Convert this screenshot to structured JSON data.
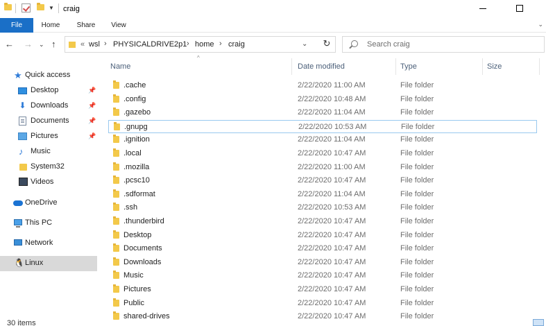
{
  "window": {
    "title": "craig"
  },
  "ribbon": {
    "tabs": [
      "File",
      "Home",
      "Share",
      "View"
    ]
  },
  "address": {
    "overflow": "«",
    "crumbs": [
      "wsl",
      "PHYSICALDRIVE2p1",
      "home",
      "craig"
    ]
  },
  "search": {
    "placeholder": "Search craig"
  },
  "nav": {
    "quick_access": "Quick access",
    "items": [
      {
        "label": "Desktop",
        "icon": "desktop-icon",
        "pinned": true
      },
      {
        "label": "Downloads",
        "icon": "download-icon",
        "pinned": true
      },
      {
        "label": "Documents",
        "icon": "document-icon",
        "pinned": true
      },
      {
        "label": "Pictures",
        "icon": "pictures-icon",
        "pinned": true
      },
      {
        "label": "Music",
        "icon": "music-icon",
        "pinned": false
      },
      {
        "label": "System32",
        "icon": "folder-icon",
        "pinned": false
      },
      {
        "label": "Videos",
        "icon": "video-icon",
        "pinned": false
      }
    ],
    "onedrive": "OneDrive",
    "thispc": "This PC",
    "network": "Network",
    "linux": "Linux"
  },
  "columns": {
    "name": "Name",
    "date": "Date modified",
    "type": "Type",
    "size": "Size"
  },
  "files": [
    {
      "name": ".cache",
      "date": "2/22/2020 11:00 AM",
      "type": "File folder"
    },
    {
      "name": ".config",
      "date": "2/22/2020 10:48 AM",
      "type": "File folder"
    },
    {
      "name": ".gazebo",
      "date": "2/22/2020 11:04 AM",
      "type": "File folder"
    },
    {
      "name": ".gnupg",
      "date": "2/22/2020 10:53 AM",
      "type": "File folder"
    },
    {
      "name": ".ignition",
      "date": "2/22/2020 11:04 AM",
      "type": "File folder"
    },
    {
      "name": ".local",
      "date": "2/22/2020 10:47 AM",
      "type": "File folder"
    },
    {
      "name": ".mozilla",
      "date": "2/22/2020 11:00 AM",
      "type": "File folder"
    },
    {
      "name": ".pcsc10",
      "date": "2/22/2020 10:47 AM",
      "type": "File folder"
    },
    {
      "name": ".sdformat",
      "date": "2/22/2020 11:04 AM",
      "type": "File folder"
    },
    {
      "name": ".ssh",
      "date": "2/22/2020 10:53 AM",
      "type": "File folder"
    },
    {
      "name": ".thunderbird",
      "date": "2/22/2020 10:47 AM",
      "type": "File folder"
    },
    {
      "name": "Desktop",
      "date": "2/22/2020 10:47 AM",
      "type": "File folder"
    },
    {
      "name": "Documents",
      "date": "2/22/2020 10:47 AM",
      "type": "File folder"
    },
    {
      "name": "Downloads",
      "date": "2/22/2020 10:47 AM",
      "type": "File folder"
    },
    {
      "name": "Music",
      "date": "2/22/2020 10:47 AM",
      "type": "File folder"
    },
    {
      "name": "Pictures",
      "date": "2/22/2020 10:47 AM",
      "type": "File folder"
    },
    {
      "name": "Public",
      "date": "2/22/2020 10:47 AM",
      "type": "File folder"
    },
    {
      "name": "shared-drives",
      "date": "2/22/2020 10:47 AM",
      "type": "File folder"
    }
  ],
  "status": {
    "count": "30 items"
  },
  "colors": {
    "accent": "#1a6fc7",
    "folder": "#f3c94a",
    "selection": "#d9d9d9",
    "focus_border": "#99c9ef"
  }
}
